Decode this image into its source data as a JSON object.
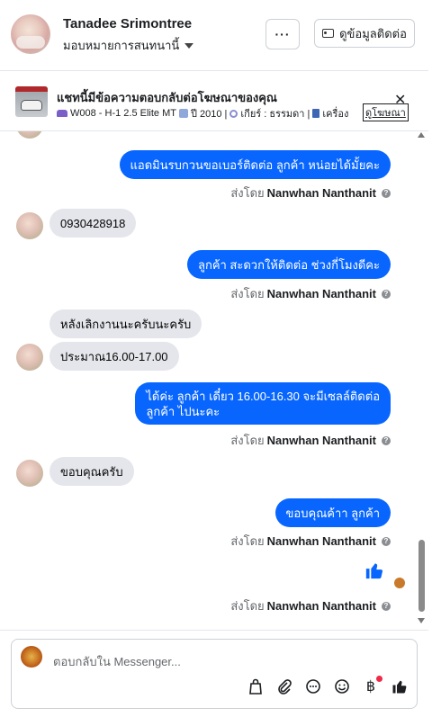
{
  "header": {
    "name": "Tanadee Srimontree",
    "assign_label": "มอบหมายการสนทนานี้",
    "more_label": "···",
    "contact_button": "ดูข้อมูลติดต่อ"
  },
  "ad_banner": {
    "title": "แชทนี้มีข้อความตอบกลับต่อโฆษณาของคุณ",
    "code": "W008 - H-1 2.5 Elite MT",
    "year": "ปี 2010 |",
    "gear": "เกียร์ : ธรรมดา |",
    "engine": "เครื่อง",
    "link": "ดูโฆษณา",
    "close": "✕"
  },
  "messages": [
    {
      "direction": "out",
      "text": "แอดมินรบกวนขอเบอร์ติดต่อ ลูกค้า หน่อยได้มั้ยคะ"
    },
    {
      "direction": "in",
      "text": "0930428918"
    },
    {
      "direction": "out",
      "text": "ลูกค้า สะดวกให้ติดต่อ ช่วงกี่โมงดีคะ"
    },
    {
      "direction": "in",
      "text": "หลังเลิกงานนะครับนะครับ"
    },
    {
      "direction": "in",
      "text": "ประมาณ16.00-17.00"
    },
    {
      "direction": "out",
      "text_line1": "ได้ค่ะ  ลูกค้า เดี๋ยว 16.00-16.30 จะมีเซลล์ติดต่อ",
      "text_line2": "ลูกค้า ไปนะคะ"
    },
    {
      "direction": "in",
      "text": "ขอบคุณครับ"
    },
    {
      "direction": "out",
      "text": "ขอบคุณค้าา ลูกค้า"
    },
    {
      "direction": "out",
      "text": "like"
    }
  ],
  "sent_by": {
    "prefix": "ส่งโดย",
    "name": "Nanwhan Nanthanit",
    "info": "?"
  },
  "composer": {
    "placeholder": "ตอบกลับใน Messenger...",
    "tool_icons": [
      "shopping-bag-icon",
      "paperclip-icon",
      "chat-bubble-icon",
      "emoji-icon",
      "baht-icon",
      "thumbs-up-icon"
    ],
    "baht": "฿"
  }
}
